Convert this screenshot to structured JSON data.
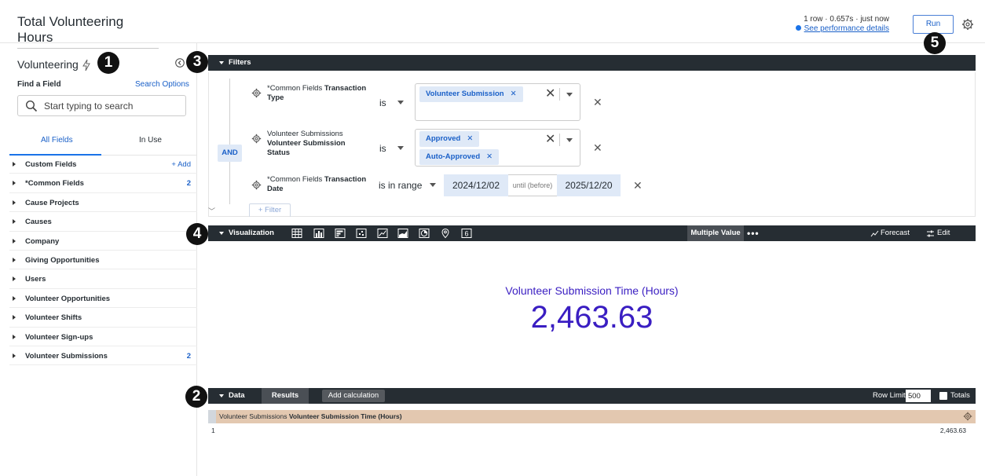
{
  "header": {
    "title": "Total Volunteering Hours",
    "run_info": "1 row · 0.657s · just now",
    "perf_link": "See performance details",
    "run_label": "Run"
  },
  "badges": {
    "one": "1",
    "two": "2",
    "three": "3",
    "four": "4",
    "five": "5"
  },
  "sidebar": {
    "explore_name": "Volunteering",
    "find_label": "Find a Field",
    "search_options": "Search Options",
    "search_placeholder": "Start typing to search",
    "tabs": {
      "all": "All Fields",
      "in_use": "In Use"
    },
    "add_label": "+ Add",
    "items": [
      {
        "label": "Custom Fields",
        "count": ""
      },
      {
        "label": "*Common Fields",
        "count": "2"
      },
      {
        "label": "Cause Projects",
        "count": ""
      },
      {
        "label": "Causes",
        "count": ""
      },
      {
        "label": "Company",
        "count": ""
      },
      {
        "label": "Giving Opportunities",
        "count": ""
      },
      {
        "label": "Users",
        "count": ""
      },
      {
        "label": "Volunteer Opportunities",
        "count": ""
      },
      {
        "label": "Volunteer Shifts",
        "count": ""
      },
      {
        "label": "Volunteer Sign-ups",
        "count": ""
      },
      {
        "label": "Volunteer Submissions",
        "count": "2"
      }
    ]
  },
  "filters": {
    "section_label": "Filters",
    "and_label": "AND",
    "add_filter": "+ Filter",
    "rows": [
      {
        "field_prefix": "*Common Fields",
        "field_bold_1": "Transaction",
        "field_bold_2": "Type",
        "operator": "is",
        "chips": [
          "Volunteer Submission"
        ]
      },
      {
        "field_prefix": "Volunteer Submissions",
        "field_bold_2": "Volunteer Submission Status",
        "operator": "is",
        "chips": [
          "Approved",
          "Auto-Approved"
        ]
      },
      {
        "field_prefix": "*Common Fields",
        "field_bold_1": "Transaction",
        "field_bold_2": "Date",
        "operator": "is in range",
        "from_date": "2024/12/02",
        "until_label": "until (before)",
        "to_date": "2025/12/20"
      }
    ]
  },
  "visualization": {
    "section_label": "Visualization",
    "icons": [
      "table-icon",
      "column-chart-icon",
      "bar-chart-icon",
      "scatter-icon",
      "line-chart-icon",
      "area-chart-icon",
      "pie-chart-icon",
      "map-pin-icon",
      "single-value-icon"
    ],
    "single_value_glyph": "6",
    "selected_type": "Multiple Value",
    "more": "•••",
    "forecast": "Forecast",
    "edit": "Edit",
    "value_title": "Volunteer Submission Time (Hours)",
    "value": "2,463.63"
  },
  "data": {
    "section_label": "Data",
    "results_tab": "Results",
    "add_calculation": "Add calculation",
    "row_limit_label": "Row Limit",
    "row_limit_value": "500",
    "totals_label": "Totals",
    "column_prefix": "Volunteer Submissions",
    "column_bold": "Volunteer Submission Time (Hours)",
    "row_number": "1",
    "row_value": "2,463.63"
  },
  "colors": {
    "accent": "#1a60c8",
    "dark_bar": "#262d33",
    "value_color": "#3a1ec2",
    "column_header": "#e3c8b0"
  }
}
